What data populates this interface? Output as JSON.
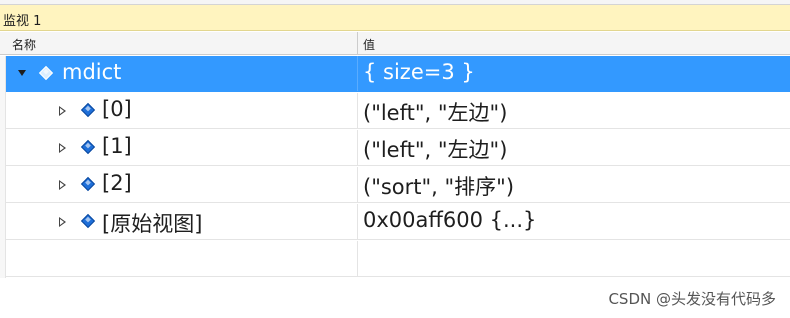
{
  "window": {
    "title": "监视 1"
  },
  "columns": {
    "name": "名称",
    "value": "值"
  },
  "rows": [
    {
      "name": "mdict",
      "value": "{ size=3 }",
      "expanded": true,
      "selected": true,
      "icon": "object-icon"
    },
    {
      "name": "[0]",
      "value": "(\"left\", \"左边\")",
      "expanded": false,
      "selected": false,
      "icon": "object-icon"
    },
    {
      "name": "[1]",
      "value": "(\"left\", \"左边\")",
      "expanded": false,
      "selected": false,
      "icon": "object-icon"
    },
    {
      "name": "[2]",
      "value": "(\"sort\", \"排序\")",
      "expanded": false,
      "selected": false,
      "icon": "object-icon"
    },
    {
      "name": "[原始视图]",
      "value": "0x00aff600 {...}",
      "expanded": false,
      "selected": false,
      "icon": "object-icon"
    }
  ],
  "watermark": "CSDN @头发没有代码多",
  "colors": {
    "selection": "#3399ff",
    "title_bar": "#fff4bf",
    "icon": "#1e6fd9"
  }
}
